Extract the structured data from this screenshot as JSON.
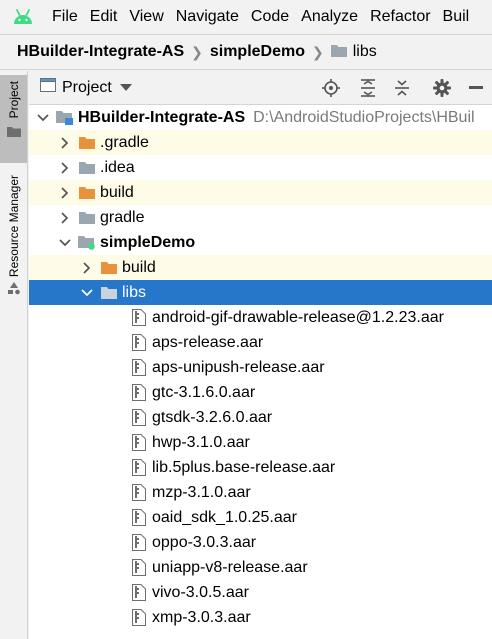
{
  "menu": {
    "logo_icon": "android-icon",
    "items": [
      "File",
      "Edit",
      "View",
      "Navigate",
      "Code",
      "Analyze",
      "Refactor",
      "Buil"
    ]
  },
  "breadcrumb": {
    "items": [
      "HBuilder-Integrate-AS",
      "simpleDemo",
      "libs"
    ]
  },
  "side_tabs": {
    "project": "Project",
    "resource_manager": "Resource Manager"
  },
  "panel": {
    "view_title": "Project",
    "toolbar_icons": [
      "locate-icon",
      "expand-all-icon",
      "collapse-all-icon",
      "settings-gear-icon",
      "hide-icon"
    ]
  },
  "tree": {
    "root": {
      "label": "HBuilder-Integrate-AS",
      "path": "D:\\AndroidStudioProjects\\HBuil"
    },
    "gradle_dot": {
      "label": ".gradle"
    },
    "idea": {
      "label": ".idea"
    },
    "build": {
      "label": "build"
    },
    "gradle": {
      "label": "gradle"
    },
    "module": {
      "label": "simpleDemo"
    },
    "module_build": {
      "label": "build"
    },
    "libs": {
      "label": "libs"
    },
    "files": [
      "android-gif-drawable-release@1.2.23.aar",
      "aps-release.aar",
      "aps-unipush-release.aar",
      "gtc-3.1.6.0.aar",
      "gtsdk-3.2.6.0.aar",
      "hwp-3.1.0.aar",
      "lib.5plus.base-release.aar",
      "mzp-3.1.0.aar",
      "oaid_sdk_1.0.25.aar",
      "oppo-3.0.3.aar",
      "uniapp-v8-release.aar",
      "vivo-3.0.5.aar",
      "xmp-3.0.3.aar"
    ]
  },
  "colors": {
    "selection": "#2677c9",
    "highlight": "#fefbe6",
    "excluded_folder": "#e8923c",
    "folder": "#9aa7b0",
    "android_green": "#3ddc84"
  }
}
